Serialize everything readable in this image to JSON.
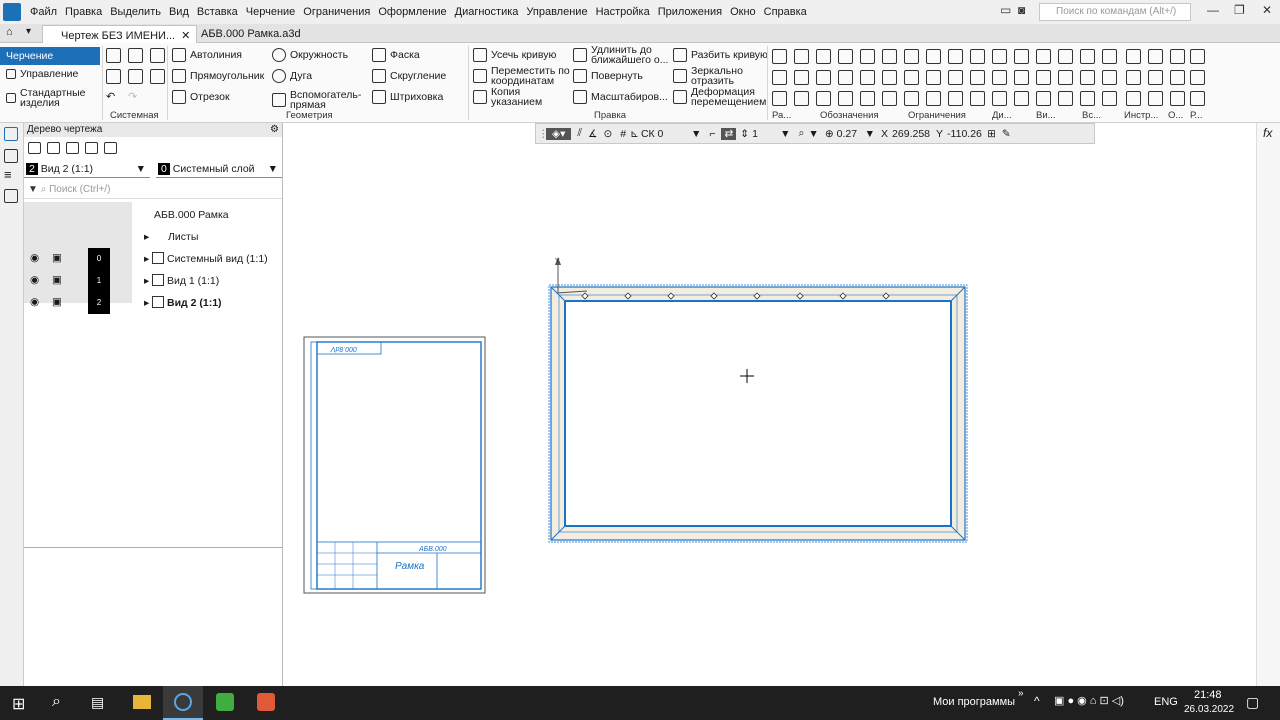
{
  "menu": [
    "Файл",
    "Правка",
    "Выделить",
    "Вид",
    "Вставка",
    "Черчение",
    "Ограничения",
    "Оформление",
    "Диагностика",
    "Управление",
    "Настройка",
    "Приложения",
    "Окно",
    "Справка"
  ],
  "search_placeholder": "Поиск по командам (Alt+/)",
  "tabs": [
    {
      "label": "Чертеж БЕЗ ИМЕНИ..."
    },
    {
      "label": "АБВ.000 Рамка.a3d"
    }
  ],
  "ribbon": {
    "modes": [
      "Черчение",
      "Управление",
      "Стандартные изделия"
    ],
    "groups": [
      "Системная",
      "Геометрия",
      "Правка",
      "Ра...",
      "Обозначения",
      "Ограничения",
      "Ди...",
      "Ви...",
      "Вс...",
      "Инстр...",
      "О...",
      "Р..."
    ],
    "geometry": [
      "Автолиния",
      "Окружность",
      "Фаска",
      "Прямоугольник",
      "Дуга",
      "Скругление",
      "Отрезок",
      "Вспомогатель- прямая",
      "Штриховка"
    ],
    "edit": [
      "Усечь кривую",
      "Удлинить до ближайшего о...",
      "Разбить кривую",
      "Переместить по координатам",
      "Повернуть",
      "Зеркально отразить",
      "Копия указанием",
      "Масштабиров...",
      "Деформация перемещением"
    ]
  },
  "tree": {
    "title": "Дерево чертежа",
    "view_select": {
      "num": "2",
      "label": "Вид 2 (1:1)"
    },
    "layer_select": {
      "num": "0",
      "label": "Системный слой"
    },
    "search_placeholder": "Поиск (Ctrl+/)",
    "doc": "АБВ.000 Рамка",
    "sheets": "Листы",
    "views": [
      {
        "num": "0",
        "label": "Системный вид (1:1)"
      },
      {
        "num": "1",
        "label": "Вид 1 (1:1)"
      },
      {
        "num": "2",
        "label": "Вид 2 (1:1)"
      }
    ]
  },
  "ctx": {
    "cs": "СК 0",
    "step": "1",
    "zoom": "0.27",
    "x_label": "X",
    "x": "269.258",
    "y_label": "Y",
    "y": "-110.26"
  },
  "sheet": {
    "designation": "АБВ.000",
    "name": "Рамка",
    "rotated_code": "000.8dV"
  },
  "axis_label": "Y",
  "rightstrip": "fx",
  "taskbar": {
    "programs": "Моил программы",
    "programs_text": "Мои программы",
    "lang": "ENG",
    "time": "21:48",
    "date": "26.03.2022"
  }
}
